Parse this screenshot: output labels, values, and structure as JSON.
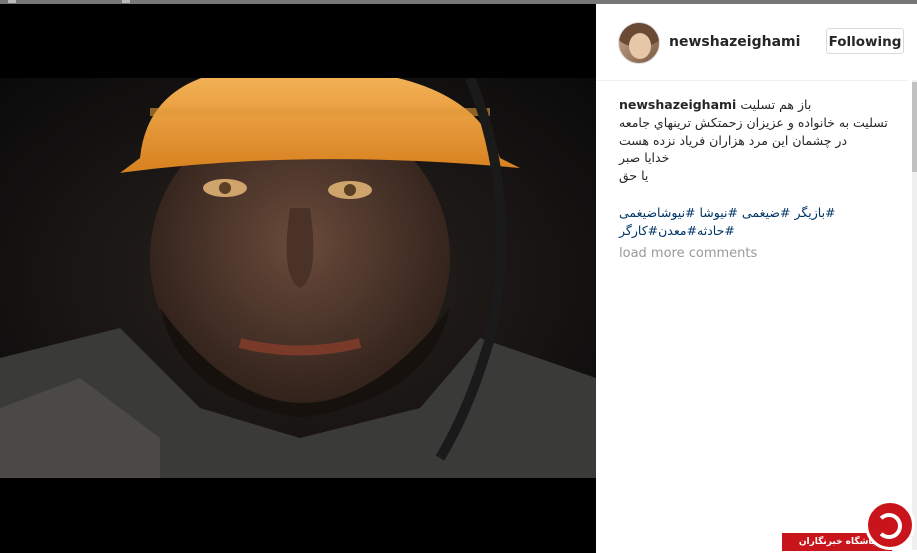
{
  "post": {
    "username": "newshazeighami",
    "follow_label": "Following",
    "caption_first": "باز هم تسلیت",
    "caption_lines": [
      "تسلیت به خانواده و عزیزان زحمتکش ترینهاي جامعه",
      "در چشمان این مرد هزاران فریاد نزده هست",
      "خدایا صبر",
      "یا حق"
    ],
    "hashtags_line1": "#بازیگر #ضیغمی #نیوشا #نیوشاضیغمی",
    "hashtags_line2": "#حادثه#معدن#کارگر",
    "load_more": "load more comments"
  },
  "watermark": {
    "text": "باشگاه خبرنگاران"
  },
  "icons": [
    "miner-photo",
    "avatar",
    "watermark-logo-icon"
  ]
}
